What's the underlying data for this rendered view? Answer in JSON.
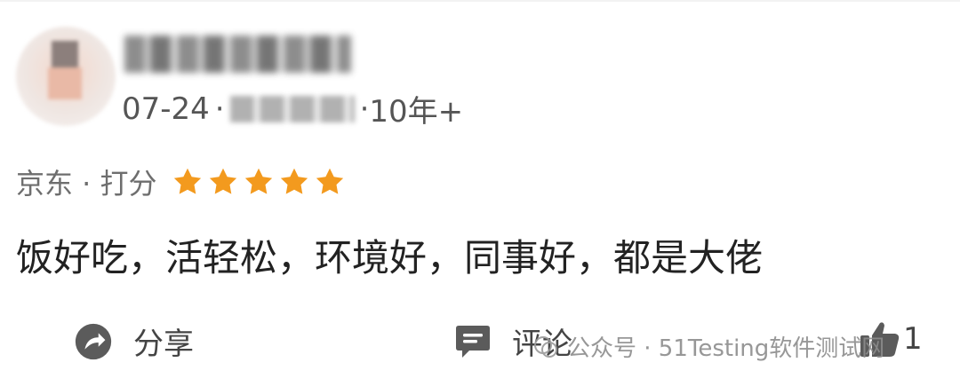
{
  "review": {
    "date": "07-24",
    "separator": "·",
    "tenure": "10年+",
    "rating_label": "京东 · 打分",
    "star_count": 5,
    "star_color": "#f39a1e",
    "text": "饭好吃，活轻松，环境好，同事好，都是大佬"
  },
  "actions": {
    "share_label": "分享",
    "comment_label": "评论",
    "like_count": "1"
  },
  "watermark": {
    "text": "公众号 · 51Testing软件测试网"
  },
  "icons": {
    "share": "share-icon",
    "comment": "comment-icon",
    "like": "thumbs-up-icon"
  }
}
